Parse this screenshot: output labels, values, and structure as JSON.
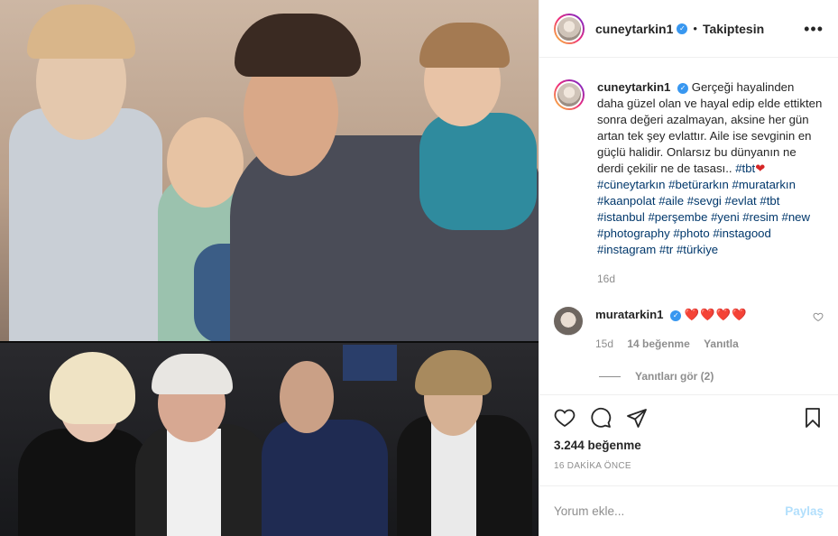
{
  "header": {
    "username": "cuneytarkin1",
    "separator": "•",
    "follow_label": "Takiptesin",
    "more_label": "•••"
  },
  "caption": {
    "username": "cuneytarkin1",
    "text": "Gerçeği hayalinden daha güzel olan ve hayal edip elde ettikten sonra değeri azalmayan, aksine her gün artan tek şey evlattır. Aile ise sevginin en güçlü halidir. Onlarsız bu dünyanın ne derdi çekilir ne de tasası.. ",
    "hashtags_line1": "#tbt",
    "heart": "❤",
    "hashtags": "#cüneytarkın #betürarkın #muratarkın #kaanpolat #aile #sevgi #evlat #tbt #istanbul #perşembe #yeni #resim #new #photography #photo #instagood #instagram #tr #türkiye",
    "age": "16d"
  },
  "reply": {
    "username": "muratarkin1",
    "hearts": "❤️❤️❤️❤️",
    "age": "15d",
    "likes": "14 beğenme",
    "reply_label": "Yanıtla",
    "view_replies": "Yanıtları gör (2)"
  },
  "actions": {
    "likes": "3.244 beğenme",
    "timestamp": "16 DAKİKA ÖNCE"
  },
  "add_comment": {
    "placeholder": "Yorum ekle...",
    "post_label": "Paylaş"
  },
  "colors": {
    "link": "#00376b",
    "muted": "#8e8e8e",
    "verified": "#3897f0",
    "post_disabled": "#b2dffc"
  }
}
